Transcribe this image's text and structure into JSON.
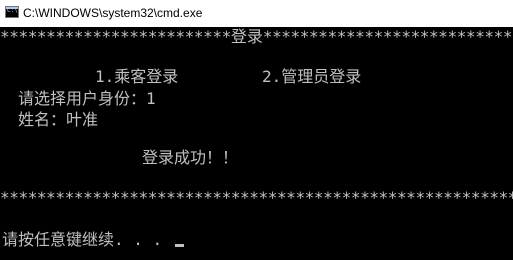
{
  "window": {
    "title": "C:\\WINDOWS\\system32\\cmd.exe",
    "icon": "cmd-icon"
  },
  "console": {
    "header_stars_left": "*************************",
    "header_title": "登录",
    "header_stars_right": "*******************************",
    "menu_option_1": "1.乘客登录",
    "menu_option_2": "2.管理员登录",
    "prompt_identity": "请选择用户身份：1",
    "prompt_name": "姓名：叶准",
    "success_message": "登录成功！！",
    "footer_stars": "***********************************************************",
    "continue_prompt": "请按任意键继续. . ."
  },
  "colors": {
    "background": "#000000",
    "text": "#c0c0c0",
    "titlebar": "#ffffff"
  }
}
